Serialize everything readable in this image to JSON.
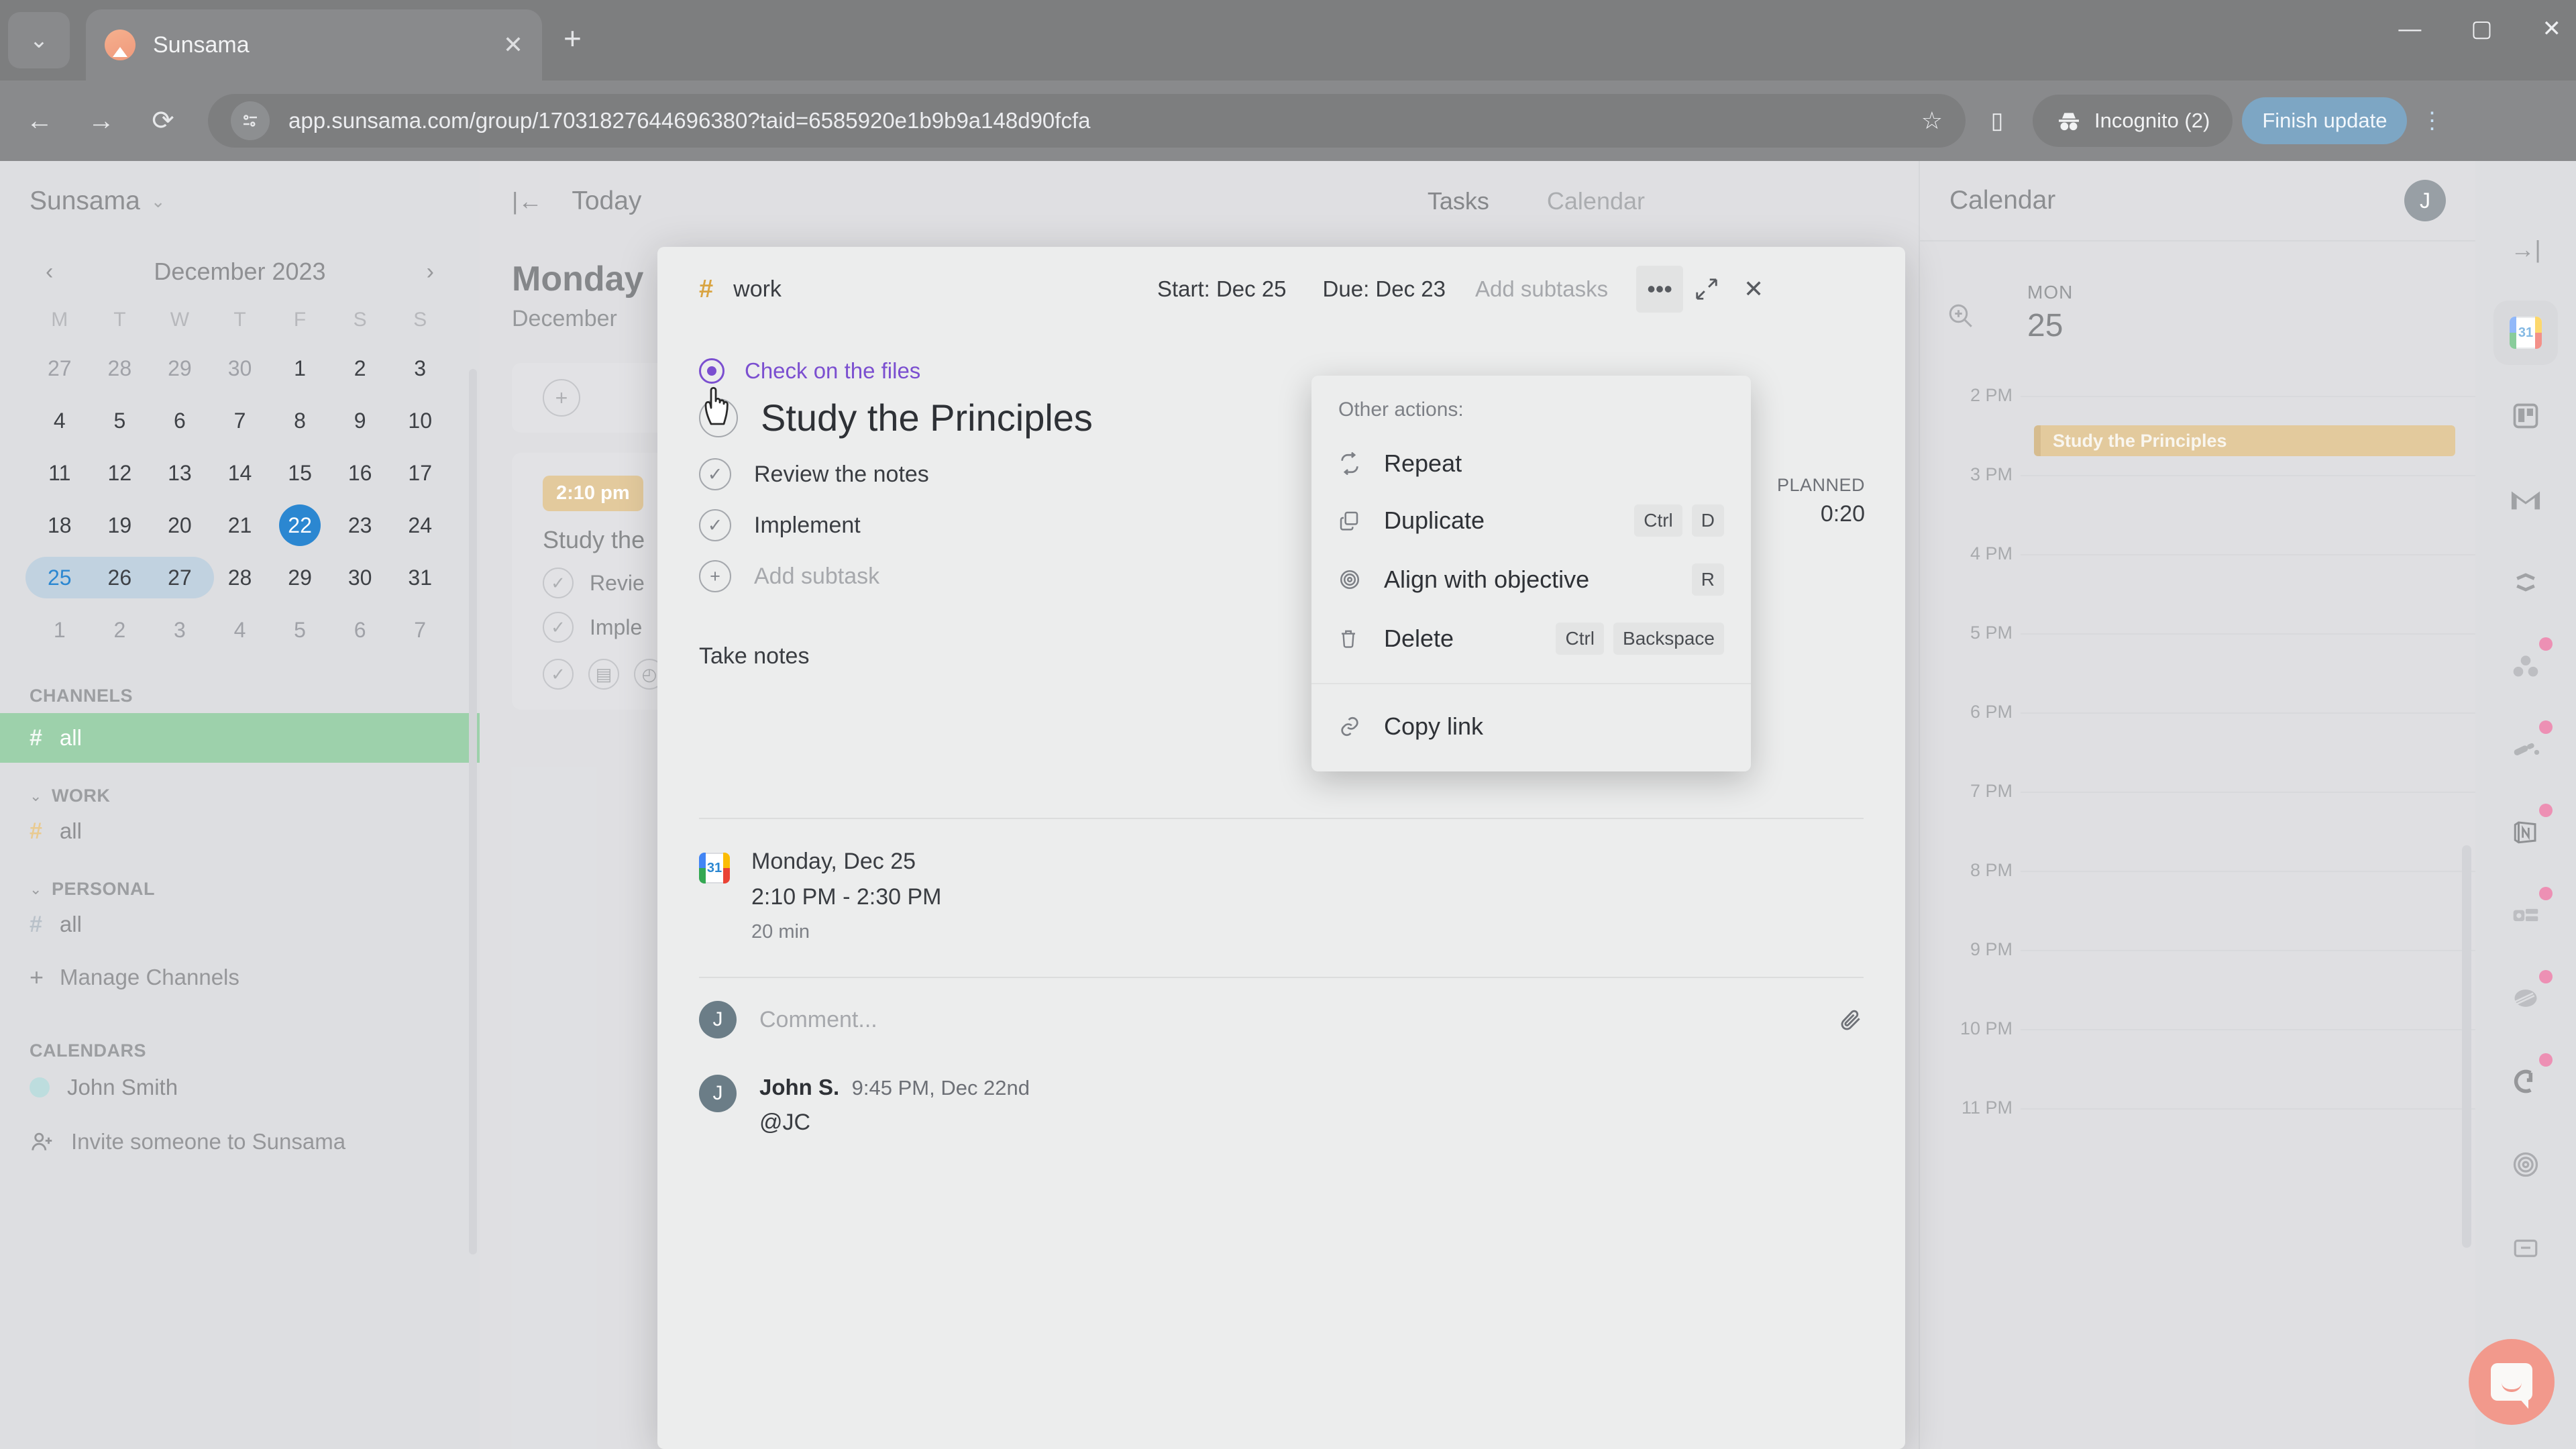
{
  "browser": {
    "tab": {
      "title": "Sunsama",
      "favicon": "sunsama-icon",
      "close": "✕"
    },
    "new_tab": "+",
    "window_controls": {
      "minimize": "—",
      "maximize": "▢",
      "close": "✕"
    },
    "nav": {
      "back": "←",
      "forward": "→",
      "reload": "⟳"
    },
    "url": "app.sunsama.com/group/17031827644696380?taid=6585920e1b9b9a148d90fcfa",
    "star": "☆",
    "side_panel": "▯",
    "incognito_label": "Incognito (2)",
    "finish_update_label": "Finish update",
    "kebab": "⋮"
  },
  "sidebar": {
    "brand": "Sunsama",
    "brand_caret": "⌄",
    "calendar": {
      "month": "December 2023",
      "prev": "‹",
      "next": "›",
      "dow": [
        "M",
        "T",
        "W",
        "T",
        "F",
        "S",
        "S"
      ],
      "weeks": [
        [
          {
            "d": "27",
            "m": true
          },
          {
            "d": "28",
            "m": true
          },
          {
            "d": "29",
            "m": true
          },
          {
            "d": "30",
            "m": true
          },
          {
            "d": "1"
          },
          {
            "d": "2"
          },
          {
            "d": "3"
          }
        ],
        [
          {
            "d": "4"
          },
          {
            "d": "5"
          },
          {
            "d": "6"
          },
          {
            "d": "7"
          },
          {
            "d": "8"
          },
          {
            "d": "9"
          },
          {
            "d": "10"
          }
        ],
        [
          {
            "d": "11"
          },
          {
            "d": "12"
          },
          {
            "d": "13"
          },
          {
            "d": "14"
          },
          {
            "d": "15"
          },
          {
            "d": "16"
          },
          {
            "d": "17"
          }
        ],
        [
          {
            "d": "18"
          },
          {
            "d": "19"
          },
          {
            "d": "20"
          },
          {
            "d": "21"
          },
          {
            "d": "22",
            "today": true
          },
          {
            "d": "23"
          },
          {
            "d": "24"
          }
        ],
        [
          {
            "d": "25",
            "sel": true
          },
          {
            "d": "26"
          },
          {
            "d": "27"
          },
          {
            "d": "28"
          },
          {
            "d": "29"
          },
          {
            "d": "30"
          },
          {
            "d": "31"
          }
        ],
        [
          {
            "d": "1",
            "m": true
          },
          {
            "d": "2",
            "m": true
          },
          {
            "d": "3",
            "m": true
          },
          {
            "d": "4",
            "m": true
          },
          {
            "d": "5",
            "m": true
          },
          {
            "d": "6",
            "m": true
          },
          {
            "d": "7",
            "m": true
          }
        ]
      ]
    },
    "channels_label": "CHANNELS",
    "channel_all": "all",
    "work_group": "WORK",
    "work_all": "all",
    "personal_group": "PERSONAL",
    "personal_all": "all",
    "manage_channels": "Manage Channels",
    "calendars_label": "CALENDARS",
    "calendar_person": "John Smith",
    "invite": "Invite someone to Sunsama",
    "accent_green": "#56b06f",
    "accent_amber": "#d9a441",
    "accent_blue": "#2b87d1"
  },
  "center": {
    "collapse_icon": "|←",
    "today_label": "Today",
    "tabs": [
      {
        "label": "Tasks",
        "active": true
      },
      {
        "label": "Calendar",
        "active": false
      }
    ],
    "day_title": "Monday",
    "day_sub": "December",
    "add_icon": "+",
    "task": {
      "time_chip": "2:10 pm",
      "name": "Study the",
      "subtasks": [
        "Revie",
        "Imple"
      ],
      "check": "✓"
    }
  },
  "modal": {
    "channel_hash": "#",
    "channel_name": "work",
    "start": "Start: Dec 25",
    "due": "Due: Dec 23",
    "add_subtasks": "Add subtasks",
    "more_icon": "•••",
    "expand_icon": "expand-icon",
    "close_icon": "✕",
    "objective": "Check on the files",
    "title": "Study the Principles",
    "subtasks": [
      {
        "label": "Review the notes",
        "check": "✓"
      },
      {
        "label": "Implement",
        "check": "✓"
      }
    ],
    "add_subtask": "Add subtask",
    "add_subtask_icon": "+",
    "notes": "Take notes",
    "schedule": {
      "date": "Monday, Dec 25",
      "time": "2:10 PM - 2:30 PM",
      "duration": "20 min",
      "icon": "google-calendar-icon"
    },
    "comment_placeholder": "Comment...",
    "comment_avatar": "J",
    "attach_icon": "📎",
    "post": {
      "avatar": "J",
      "author": "John S.",
      "time": "9:45 PM, Dec 22nd",
      "text": "@JC"
    },
    "planned_label": "PLANNED",
    "planned_value": "0:20"
  },
  "dropdown": {
    "label": "Other actions:",
    "items": [
      {
        "icon": "repeat-icon",
        "label": "Repeat",
        "keys": []
      },
      {
        "icon": "duplicate-icon",
        "label": "Duplicate",
        "keys": [
          "Ctrl",
          "D"
        ]
      },
      {
        "icon": "target-icon",
        "label": "Align with objective",
        "keys": [
          "R"
        ]
      },
      {
        "icon": "trash-icon",
        "label": "Delete",
        "keys": [
          "Ctrl",
          "Backspace"
        ]
      }
    ],
    "footer": {
      "icon": "link-icon",
      "label": "Copy link"
    }
  },
  "right_panel": {
    "title": "Calendar",
    "avatar": "J",
    "zoom_icon": "zoom-in-icon",
    "day_of_week": "MON",
    "day_number": "25",
    "hours": [
      "2 PM",
      "3 PM",
      "4 PM",
      "5 PM",
      "6 PM",
      "7 PM",
      "8 PM",
      "9 PM",
      "10 PM",
      "11 PM"
    ],
    "event": {
      "title": "Study the Principles",
      "color": "#cfa456"
    }
  },
  "rail": {
    "collapse": "→|",
    "items": [
      {
        "name": "google-calendar-icon",
        "selected": true,
        "badge": false
      },
      {
        "name": "trello-icon",
        "selected": false,
        "badge": false
      },
      {
        "name": "gmail-icon",
        "selected": false,
        "badge": false
      },
      {
        "name": "hubspot-icon",
        "selected": false,
        "badge": false
      },
      {
        "name": "asana-icon",
        "selected": false,
        "badge": true
      },
      {
        "name": "linear-icon",
        "selected": false,
        "badge": true
      },
      {
        "name": "notion-icon",
        "selected": false,
        "badge": true
      },
      {
        "name": "clickup-icon",
        "selected": false,
        "badge": true
      },
      {
        "name": "slack-icon",
        "selected": false,
        "badge": true
      },
      {
        "name": "github-icon",
        "selected": false,
        "badge": true
      },
      {
        "name": "objectives-icon",
        "selected": false,
        "badge": false
      }
    ],
    "intercom": "intercom-launcher"
  }
}
